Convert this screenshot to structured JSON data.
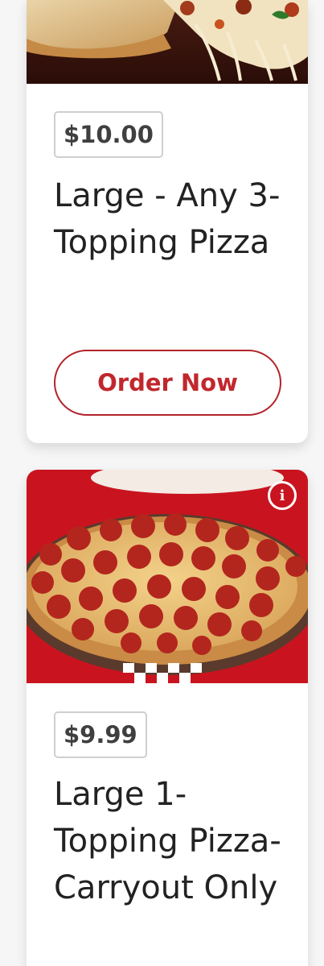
{
  "offers": [
    {
      "price": "$10.00",
      "title": "Large - Any 3-Topping Pizza",
      "button_label": "Order Now",
      "image_icon": "pizza-cheese-pull-photo"
    },
    {
      "price": "$9.99",
      "title": "Large 1-Topping Pizza-Carryout Only",
      "image_icon": "pepperoni-pizza-photo",
      "info_glyph": "i"
    }
  ],
  "colors": {
    "accent_red": "#c1272d",
    "badge_border": "#cfcfcf",
    "page_background": "#f6f6f6"
  }
}
